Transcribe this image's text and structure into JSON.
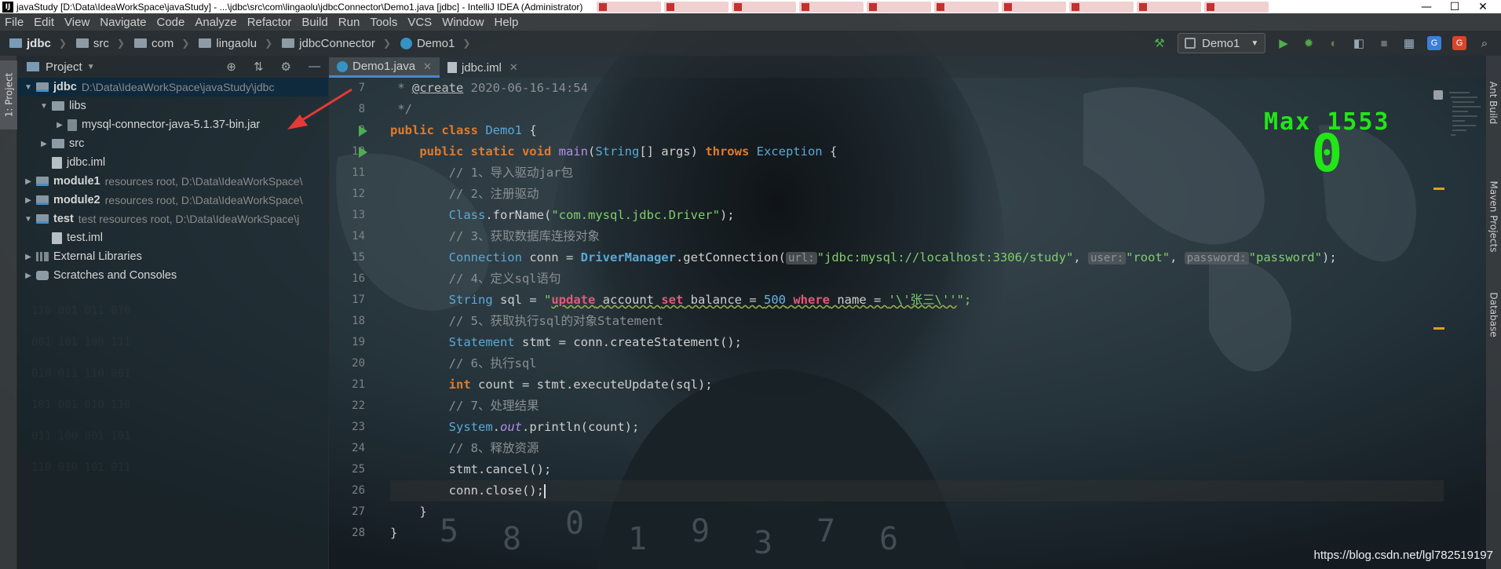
{
  "window": {
    "title": "javaStudy [D:\\Data\\IdeaWorkSpace\\javaStudy] - ...\\jdbc\\src\\com\\lingaolu\\jdbcConnector\\Demo1.java [jdbc] - IntelliJ IDEA (Administrator)",
    "app_icon": "IJ",
    "controls": [
      "—",
      "☐",
      "✕"
    ]
  },
  "menu": [
    "File",
    "Edit",
    "View",
    "Navigate",
    "Code",
    "Analyze",
    "Refactor",
    "Build",
    "Run",
    "Tools",
    "VCS",
    "Window",
    "Help"
  ],
  "breadcrumb": [
    "jdbc",
    "src",
    "com",
    "lingaolu",
    "jdbcConnector",
    "Demo1"
  ],
  "toolbar": {
    "run_config": "Demo1",
    "icons": [
      "hammer-icon",
      "run-icon",
      "debug-icon",
      "coverage-icon",
      "profile-icon",
      "stop-icon",
      "project-structure-icon",
      "translate-icon",
      "translate-g-icon",
      "search-everywhere-icon"
    ]
  },
  "left_stripe": {
    "project_tab": "1: Project"
  },
  "project_panel": {
    "title": "Project",
    "tree": [
      {
        "name": "jdbc",
        "path": "D:\\Data\\IdeaWorkSpace\\javaStudy\\jdbc",
        "bold": true,
        "expanded": true,
        "icon": "module"
      },
      {
        "name": "libs",
        "path": "",
        "bold": false,
        "expanded": true,
        "icon": "folder"
      },
      {
        "name": "mysql-connector-java-5.1.37-bin.jar",
        "path": "",
        "bold": false,
        "expanded": false,
        "icon": "jar"
      },
      {
        "name": "src",
        "path": "",
        "bold": false,
        "expanded": false,
        "icon": "folder"
      },
      {
        "name": "jdbc.iml",
        "path": "",
        "bold": false,
        "icon": "xml"
      },
      {
        "name": "module1",
        "path": "resources root,  D:\\Data\\IdeaWorkSpace\\",
        "bold": true,
        "expanded": false,
        "icon": "module"
      },
      {
        "name": "module2",
        "path": "resources root,  D:\\Data\\IdeaWorkSpace\\",
        "bold": true,
        "expanded": false,
        "icon": "module"
      },
      {
        "name": "test",
        "path": "test resources root,  D:\\Data\\IdeaWorkSpace\\j",
        "bold": true,
        "expanded": true,
        "icon": "module"
      },
      {
        "name": "test.iml",
        "path": "",
        "bold": false,
        "icon": "xml"
      },
      {
        "name": "External Libraries",
        "path": "",
        "bold": false,
        "expanded": false,
        "icon": "lib"
      },
      {
        "name": "Scratches and Consoles",
        "path": "",
        "bold": false,
        "expanded": false,
        "icon": "scratch"
      }
    ]
  },
  "editor": {
    "tabs": [
      {
        "label": "Demo1.java",
        "active": true
      },
      {
        "label": "jdbc.iml",
        "active": false
      }
    ],
    "line_numbers": [
      "7",
      "8",
      "9",
      "10",
      "11",
      "12",
      "13",
      "14",
      "15",
      "16",
      "17",
      "18",
      "19",
      "20",
      "21",
      "22",
      "23",
      "24",
      "25",
      "26",
      "27",
      "28"
    ],
    "code": {
      "l7_a": " * ",
      "l7_tag": "@create",
      "l7_b": " 2020-06-16-14:54",
      "l8": " */",
      "l9_kw": "public class ",
      "l9_cls": "Demo1",
      "l9_b": " {",
      "l10_kw": "public static void ",
      "l10_fn": "main",
      "l10_b": "(",
      "l10_type": "String",
      "l10_c": "[] args) ",
      "l10_kw2": "throws ",
      "l10_exc": "Exception",
      "l10_d": " {",
      "l11": "// 1、导入驱动jar包",
      "l12": "// 2、注册驱动",
      "l13_cls": "Class",
      "l13_b": ".forName(",
      "l13_str": "\"com.mysql.jdbc.Driver\"",
      "l13_c": ");",
      "l14": "// 3、获取数据库连接对象",
      "l15_type": "Connection",
      "l15_b": " conn = ",
      "l15_cls": "DriverManager",
      "l15_c": ".getConnection(",
      "l15_h1": "url:",
      "l15_s1": "\"jdbc:mysql://localhost:3306/study\"",
      "l15_d": ", ",
      "l15_h2": "user:",
      "l15_s2": "\"root\"",
      "l15_e": ", ",
      "l15_h3": "password:",
      "l15_s3": "\"password\"",
      "l15_f": ");",
      "l16": "// 4、定义sql语句",
      "l17_type": "String",
      "l17_b": " sql = ",
      "l17_q": "\"",
      "l17_kw1": "update",
      "l17_s1": " account ",
      "l17_kw2": "set",
      "l17_s2": " balance = ",
      "l17_num": "500",
      "l17_s3": " ",
      "l17_kw3": "where",
      "l17_s4": " name = ",
      "l17_s5": "'\\'张三\\''",
      "l17_end": "\";",
      "l18": "// 5、获取执行sql的对象Statement",
      "l19_type": "Statement",
      "l19_b": " stmt = conn.createStatement();",
      "l20": "// 6、执行sql",
      "l21_kw": "int",
      "l21_b": " count = stmt.executeUpdate(sql);",
      "l22": "// 7、处理结果",
      "l23_cls": "System",
      "l23_b": ".",
      "l23_out": "out",
      "l23_c": ".println(count);",
      "l24": "// 8、释放资源",
      "l25": "stmt.cancel();",
      "l26": "conn.close();",
      "l27": "}",
      "l28": "}"
    }
  },
  "score_overlay": {
    "label": "Max",
    "max": "1553",
    "current": "0"
  },
  "right_stripe": [
    "Ant Build",
    "Maven Projects",
    "Database"
  ],
  "watermark": "https://blog.csdn.net/lgl782519197",
  "colors": {
    "accent": "#4a88c7",
    "score": "#22e616",
    "keyword": "#e07b2d",
    "string": "#7fcf6a"
  }
}
